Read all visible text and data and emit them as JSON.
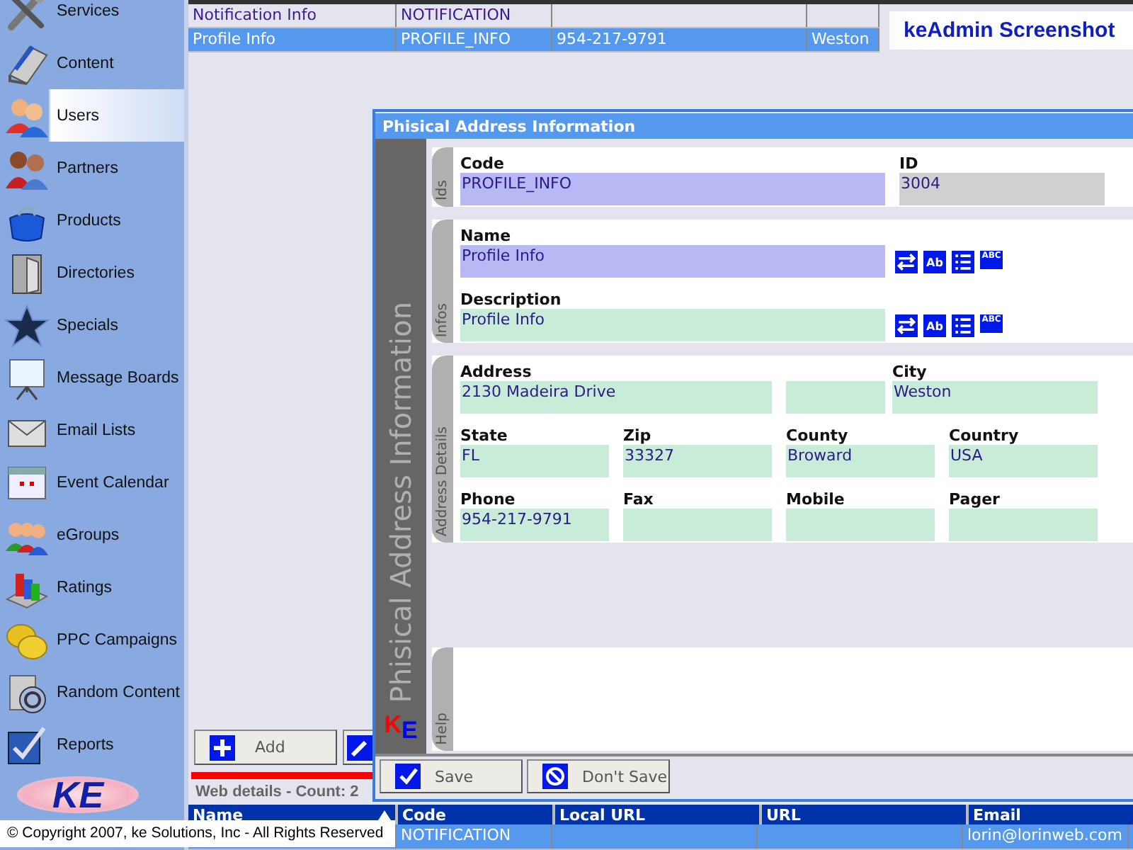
{
  "sidebar": {
    "items": [
      {
        "label": "Services",
        "selected": false
      },
      {
        "label": "Content",
        "selected": false
      },
      {
        "label": "Users",
        "selected": true
      },
      {
        "label": "Partners",
        "selected": false
      },
      {
        "label": "Products",
        "selected": false
      },
      {
        "label": "Directories",
        "selected": false
      },
      {
        "label": "Specials",
        "selected": false
      },
      {
        "label": "Message Boards",
        "selected": false
      },
      {
        "label": "Email Lists",
        "selected": false
      },
      {
        "label": "Event Calendar",
        "selected": false
      },
      {
        "label": "eGroups",
        "selected": false
      },
      {
        "label": "Ratings",
        "selected": false
      },
      {
        "label": "PPC Campaigns",
        "selected": false
      },
      {
        "label": "Random Content",
        "selected": false
      },
      {
        "label": "Reports",
        "selected": false
      }
    ],
    "logo": "KE"
  },
  "banner": {
    "title": "keAdmin Screenshot"
  },
  "top_grid": {
    "rows": [
      {
        "cells": [
          "Notification Info",
          "NOTIFICATION",
          null,
          null
        ],
        "selected": false
      },
      {
        "cells": [
          "Profile Info",
          "PROFILE_INFO",
          "954-217-9791",
          "Weston"
        ],
        "selected": true
      }
    ]
  },
  "toolbar": {
    "buttons": [
      {
        "kind": "add",
        "label": "Add"
      },
      {
        "kind": "edit"
      }
    ]
  },
  "details": {
    "title": "Web details - Count: 2",
    "columns": [
      {
        "label": "Name",
        "sorted": true
      },
      {
        "label": "Code",
        "sorted": false
      },
      {
        "label": "Local URL",
        "sorted": false
      },
      {
        "label": "URL",
        "sorted": false
      },
      {
        "label": "Email",
        "sorted": false
      }
    ],
    "rows": [
      {
        "cells": [
          null,
          "NOTIFICATION",
          null,
          null,
          "lorin@lorinweb.com"
        ],
        "selected": true
      }
    ]
  },
  "dialog": {
    "title": "Phisical Address Information",
    "side_title": "Phisical Address Information",
    "logo": "$^{K}$E",
    "sections": [
      {
        "label": "Ids",
        "rows": [
          {
            "fields": [
              {
                "label": "Code",
                "value": "PROFILE_INFO",
                "kind": "required"
              },
              {
                "label": "ID",
                "value": "3004",
                "kind": "readonly"
              }
            ]
          }
        ]
      },
      {
        "label": "Infos",
        "rows": [
          {
            "fields": [
              {
                "label": "Name",
                "value": "Profile Info",
                "kind": "required"
              }
            ],
            "tools": [
              {
                "kind": "swap"
              },
              {
                "kind": "format",
                "text": "Ab"
              },
              {
                "kind": "list"
              },
              {
                "kind": "spell",
                "text": "ABC"
              }
            ]
          },
          {
            "fields": [
              {
                "label": "Description",
                "value": "Profile Info",
                "kind": "optional"
              }
            ],
            "tools": [
              {
                "kind": "swap"
              },
              {
                "kind": "format",
                "text": "Ab"
              },
              {
                "kind": "list"
              },
              {
                "kind": "spell",
                "text": "ABC"
              }
            ]
          }
        ]
      },
      {
        "label": "Address Details",
        "rows": [
          {
            "fields": [
              {
                "label": "Address",
                "value": "2130 Madeira Drive",
                "kind": "optional"
              },
              {
                "kind": "optional"
              },
              {
                "label": "City",
                "value": "Weston",
                "kind": "optional"
              }
            ]
          },
          {
            "fields": [
              {
                "label": "State",
                "value": "FL",
                "kind": "optional"
              },
              {
                "label": "Zip",
                "value": "33327",
                "kind": "optional"
              },
              {
                "label": "County",
                "value": "Broward",
                "kind": "optional"
              },
              {
                "label": "Country",
                "value": "USA",
                "kind": "optional"
              }
            ]
          },
          {
            "fields": [
              {
                "label": "Phone",
                "value": "954-217-9791",
                "kind": "optional"
              },
              {
                "label": "Fax",
                "kind": "optional"
              },
              {
                "label": "Mobile",
                "kind": "optional"
              },
              {
                "label": "Pager",
                "kind": "optional"
              }
            ]
          }
        ]
      },
      {
        "label": "Help",
        "kind": "help"
      }
    ],
    "buttons": [
      {
        "kind": "save",
        "label": "Save"
      },
      {
        "kind": "cancel",
        "label": "Don't Save"
      }
    ]
  },
  "copyright": "© Copyright 2007, ke Solutions, Inc - All Rights Reserved"
}
